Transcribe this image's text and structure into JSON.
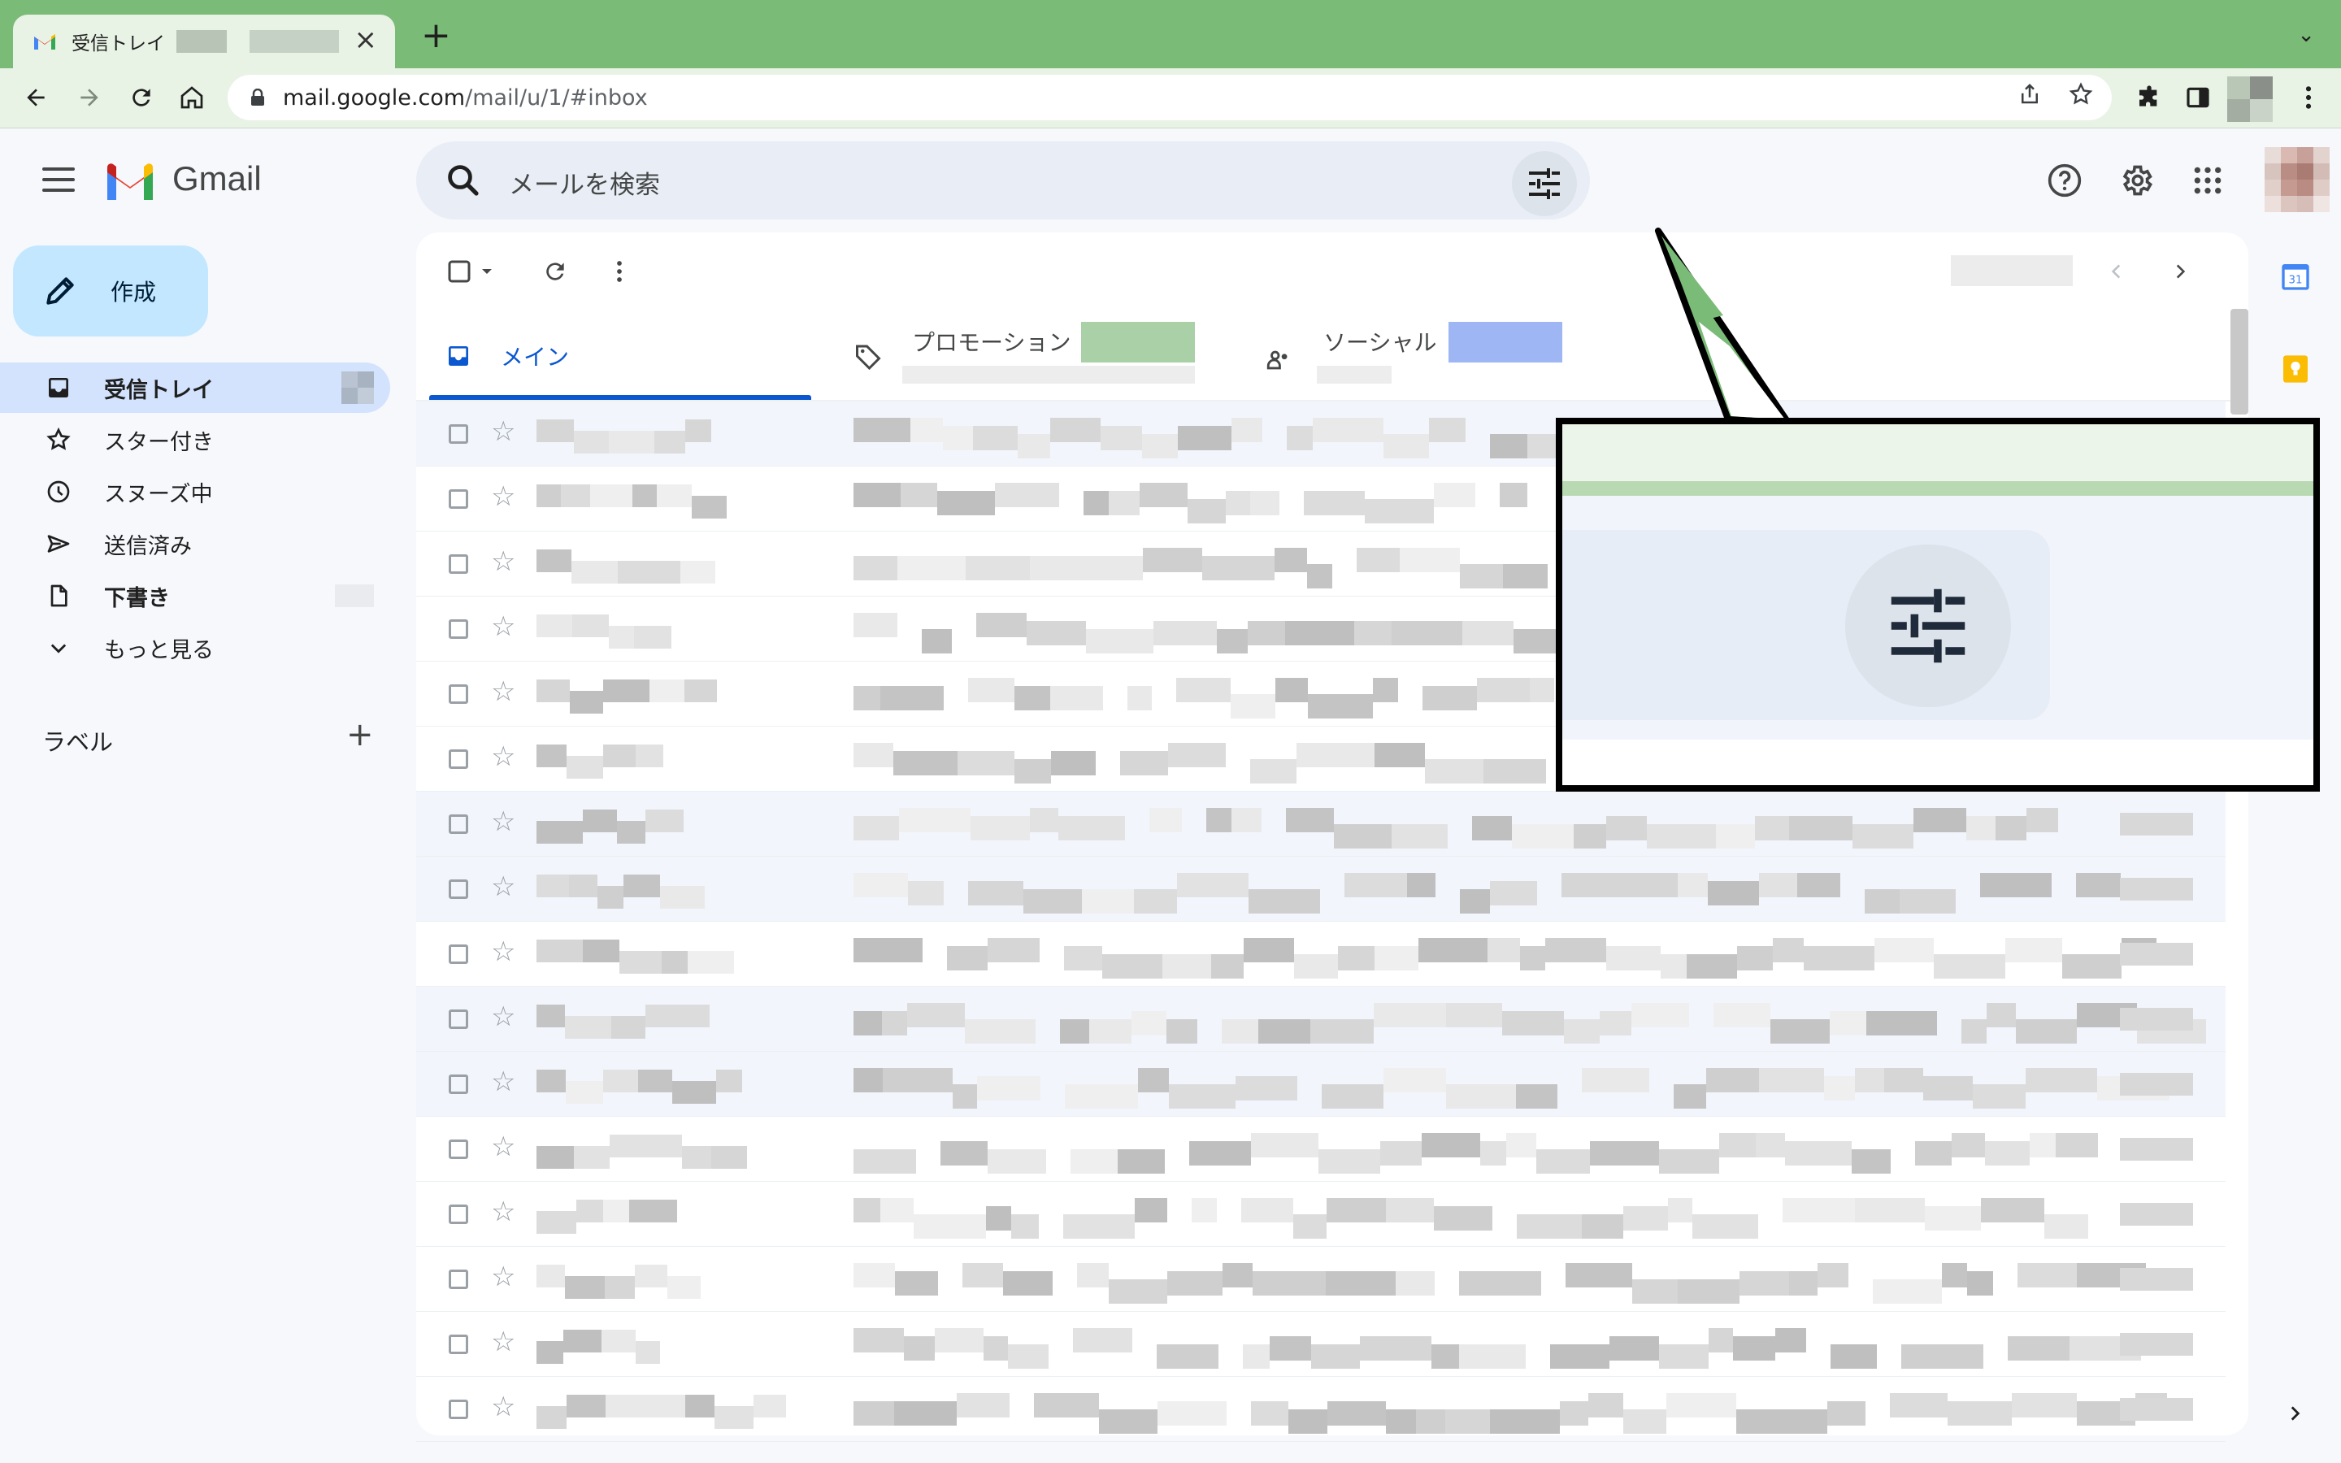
{
  "browser": {
    "tab_title": "受信トレイ",
    "url_host": "mail.google.com",
    "url_path": "/mail/u/1/#inbox"
  },
  "gmail": {
    "product_name": "Gmail",
    "search_placeholder": "メールを検索",
    "compose_label": "作成",
    "nav": [
      {
        "label": "受信トレイ",
        "icon": "inbox-icon"
      },
      {
        "label": "スター付き",
        "icon": "star-icon"
      },
      {
        "label": "スヌーズ中",
        "icon": "clock-icon"
      },
      {
        "label": "送信済み",
        "icon": "send-icon"
      },
      {
        "label": "下書き",
        "icon": "draft-icon"
      },
      {
        "label": "もっと見る",
        "icon": "chevron-down-icon"
      }
    ],
    "labels_title": "ラベル",
    "labels_add": "+",
    "categories": [
      {
        "label": "メイン",
        "icon": "inbox-tab-icon"
      },
      {
        "label": "プロモーション",
        "icon": "tag-icon"
      },
      {
        "label": "ソーシャル",
        "icon": "people-icon"
      }
    ]
  },
  "colors": {
    "tab_strip": "#7bbb78",
    "toolbar": "#e8f3e5",
    "accent_blue": "#0b57d0",
    "compose_bg": "#c2e7ff",
    "active_nav": "#d3e3fd"
  }
}
